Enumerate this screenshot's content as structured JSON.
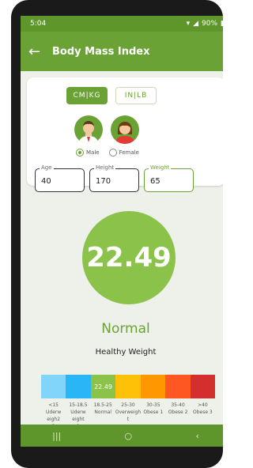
{
  "status_bar": {
    "time": "5:04",
    "battery": "90%"
  },
  "app_bar": {
    "title": "Body Mass Index"
  },
  "units": {
    "metric": "CM|KG",
    "imperial": "IN|LB"
  },
  "gender": {
    "male": "Male",
    "female": "Female"
  },
  "fields": {
    "age": {
      "label": "Age",
      "value": "40"
    },
    "height": {
      "label": "Height",
      "value": "170"
    },
    "weight": {
      "label": "Weight",
      "value": "65"
    }
  },
  "result": {
    "bmi": "22.49",
    "category": "Normal",
    "description": "Healthy Weight"
  },
  "scale": {
    "segments": [
      {
        "color": "#81d4fa",
        "text": ""
      },
      {
        "color": "#29b6f6",
        "text": ""
      },
      {
        "color": "#8bc34a",
        "text": "22.49"
      },
      {
        "color": "#ffc107",
        "text": ""
      },
      {
        "color": "#ff9800",
        "text": ""
      },
      {
        "color": "#ff5722",
        "text": ""
      },
      {
        "color": "#d32f2f",
        "text": ""
      }
    ],
    "labels": [
      [
        "<15",
        "Uderw",
        "eigh2",
        "2"
      ],
      [
        "15-18.5",
        "Uderw",
        "eight",
        "1"
      ],
      [
        "18.5-25",
        "Normal"
      ],
      [
        "25-30",
        "Overweigh",
        "t"
      ],
      [
        "30-35",
        "Obese 1"
      ],
      [
        "35-40",
        "Obese 2"
      ],
      [
        ">40",
        "Obese 3"
      ]
    ]
  },
  "nav": {
    "recents": "|||",
    "home": "○",
    "back": "‹"
  },
  "colors": {
    "primary": "#6aa235",
    "primary_dark": "#5f962b",
    "bmi_circle": "#8bc34a"
  }
}
